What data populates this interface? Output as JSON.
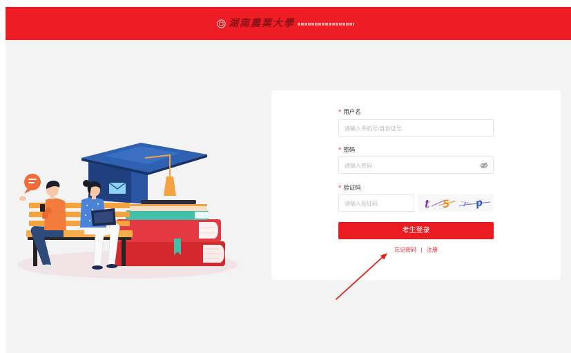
{
  "header": {
    "logo_text": "湖南農業大學",
    "logo_icon": "university-seal-icon"
  },
  "theme": {
    "primary_red": "#ee1c24",
    "button_red": "#ea1b21",
    "page_bg": "#f3f3f3",
    "card_bg": "#ffffff"
  },
  "login": {
    "username": {
      "required_mark": "*",
      "label": "用户名",
      "placeholder": "请输入手机号/身份证号"
    },
    "password": {
      "required_mark": "*",
      "label": "密码",
      "placeholder": "请输入密码",
      "toggle_icon": "eye-off-icon"
    },
    "captcha": {
      "required_mark": "*",
      "label": "验证码",
      "placeholder": "请输入验证码",
      "chars": [
        {
          "char": "t",
          "color": "#7b3fb0"
        },
        {
          "char": "5",
          "color": "#f08a1c"
        },
        {
          "char": "r",
          "color": "#6a5acd"
        },
        {
          "char": "p",
          "color": "#2d58b8"
        }
      ]
    },
    "submit_label": "考生登录",
    "forgot_password_label": "忘记密码",
    "link_separator": "|",
    "register_label": "注册"
  },
  "annotation": {
    "arrow_icon": "red-arrow-icon",
    "color": "#e3241c"
  }
}
